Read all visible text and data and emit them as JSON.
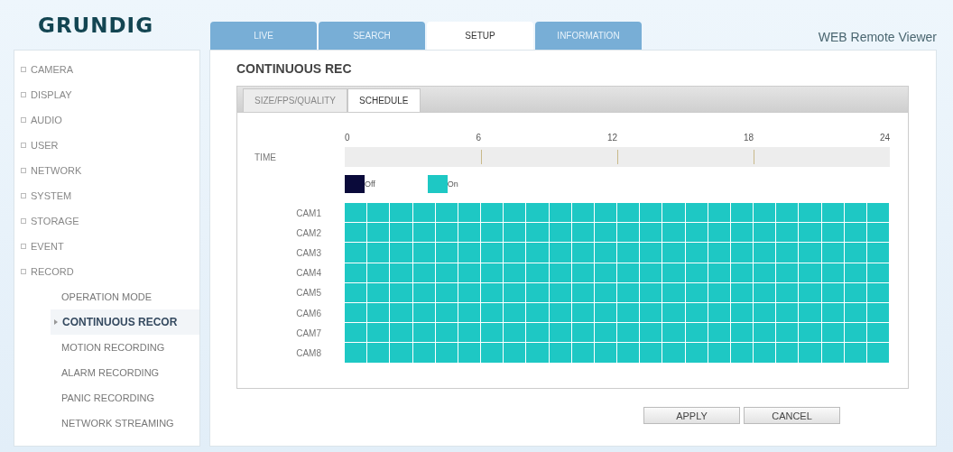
{
  "header": {
    "logo": "GRUNDIG",
    "subtitle": "WEB Remote Viewer"
  },
  "tabs": [
    {
      "label": "LIVE",
      "selected": false
    },
    {
      "label": "SEARCH",
      "selected": false
    },
    {
      "label": "SETUP",
      "selected": true
    },
    {
      "label": "INFORMATION",
      "selected": false
    }
  ],
  "sidebar": {
    "items": [
      {
        "label": "CAMERA"
      },
      {
        "label": "DISPLAY"
      },
      {
        "label": "AUDIO"
      },
      {
        "label": "USER"
      },
      {
        "label": "NETWORK"
      },
      {
        "label": "SYSTEM"
      },
      {
        "label": "STORAGE"
      },
      {
        "label": "EVENT"
      },
      {
        "label": "RECORD",
        "children": [
          {
            "label": "OPERATION MODE",
            "selected": false
          },
          {
            "label": "CONTINUOUS RECOR",
            "selected": true
          },
          {
            "label": "MOTION RECORDING",
            "selected": false
          },
          {
            "label": "ALARM RECORDING",
            "selected": false
          },
          {
            "label": "PANIC RECORDING",
            "selected": false
          },
          {
            "label": "NETWORK STREAMING",
            "selected": false
          }
        ]
      }
    ]
  },
  "page_title": "CONTINUOUS REC",
  "subtabs": [
    {
      "label": "SIZE/FPS/QUALITY",
      "selected": false
    },
    {
      "label": "SCHEDULE",
      "selected": true
    }
  ],
  "time": {
    "label": "TIME",
    "ticks": [
      "0",
      "6",
      "12",
      "18",
      "24"
    ]
  },
  "legend": [
    {
      "label": "Off",
      "color": "#0a0a3a"
    },
    {
      "label": "On",
      "color": "#1ec8c4"
    }
  ],
  "schedule": [
    {
      "camera": "CAM1",
      "hours": [
        true,
        true,
        true,
        true,
        true,
        true,
        true,
        true,
        true,
        true,
        true,
        true,
        true,
        true,
        true,
        true,
        true,
        true,
        true,
        true,
        true,
        true,
        true,
        true
      ]
    },
    {
      "camera": "CAM2",
      "hours": [
        true,
        true,
        true,
        true,
        true,
        true,
        true,
        true,
        true,
        true,
        true,
        true,
        true,
        true,
        true,
        true,
        true,
        true,
        true,
        true,
        true,
        true,
        true,
        true
      ]
    },
    {
      "camera": "CAM3",
      "hours": [
        true,
        true,
        true,
        true,
        true,
        true,
        true,
        true,
        true,
        true,
        true,
        true,
        true,
        true,
        true,
        true,
        true,
        true,
        true,
        true,
        true,
        true,
        true,
        true
      ]
    },
    {
      "camera": "CAM4",
      "hours": [
        true,
        true,
        true,
        true,
        true,
        true,
        true,
        true,
        true,
        true,
        true,
        true,
        true,
        true,
        true,
        true,
        true,
        true,
        true,
        true,
        true,
        true,
        true,
        true
      ]
    },
    {
      "camera": "CAM5",
      "hours": [
        true,
        true,
        true,
        true,
        true,
        true,
        true,
        true,
        true,
        true,
        true,
        true,
        true,
        true,
        true,
        true,
        true,
        true,
        true,
        true,
        true,
        true,
        true,
        true
      ]
    },
    {
      "camera": "CAM6",
      "hours": [
        true,
        true,
        true,
        true,
        true,
        true,
        true,
        true,
        true,
        true,
        true,
        true,
        true,
        true,
        true,
        true,
        true,
        true,
        true,
        true,
        true,
        true,
        true,
        true
      ]
    },
    {
      "camera": "CAM7",
      "hours": [
        true,
        true,
        true,
        true,
        true,
        true,
        true,
        true,
        true,
        true,
        true,
        true,
        true,
        true,
        true,
        true,
        true,
        true,
        true,
        true,
        true,
        true,
        true,
        true
      ]
    },
    {
      "camera": "CAM8",
      "hours": [
        true,
        true,
        true,
        true,
        true,
        true,
        true,
        true,
        true,
        true,
        true,
        true,
        true,
        true,
        true,
        true,
        true,
        true,
        true,
        true,
        true,
        true,
        true,
        true
      ]
    }
  ],
  "buttons": [
    "APPLY",
    "CANCEL"
  ]
}
